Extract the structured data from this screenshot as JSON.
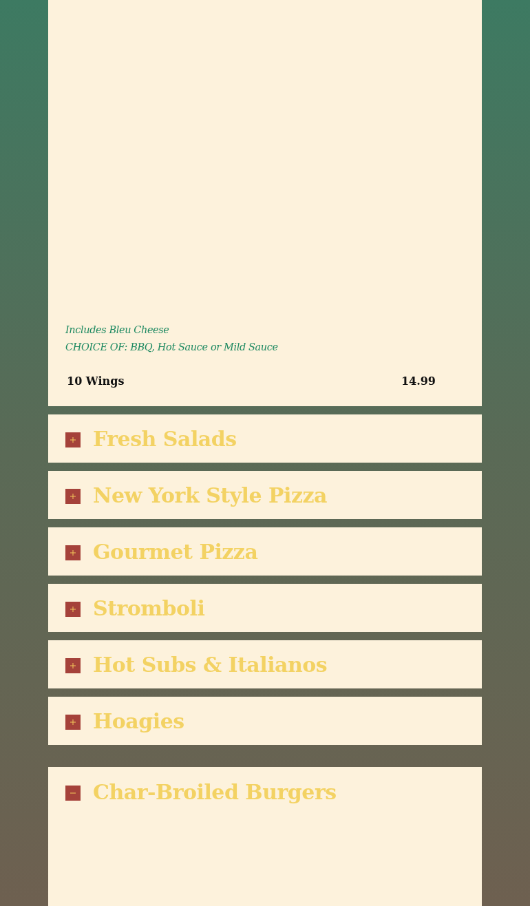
{
  "top_panel": {
    "notes": [
      "Includes Bleu Cheese",
      "CHOICE OF: BBQ, Hot Sauce or Mild Sauce"
    ],
    "items": [
      {
        "name": "10 Wings",
        "price": "14.99"
      }
    ]
  },
  "sections": [
    {
      "title": "Fresh Salads",
      "expanded": false
    },
    {
      "title": "New York Style Pizza",
      "expanded": false
    },
    {
      "title": "Gourmet Pizza",
      "expanded": false
    },
    {
      "title": "Stromboli",
      "expanded": false
    },
    {
      "title": "Hot Subs & Italianos",
      "expanded": false
    },
    {
      "title": "Hoagies",
      "expanded": false
    },
    {
      "title": "Char-Broiled Burgers",
      "expanded": true
    }
  ]
}
